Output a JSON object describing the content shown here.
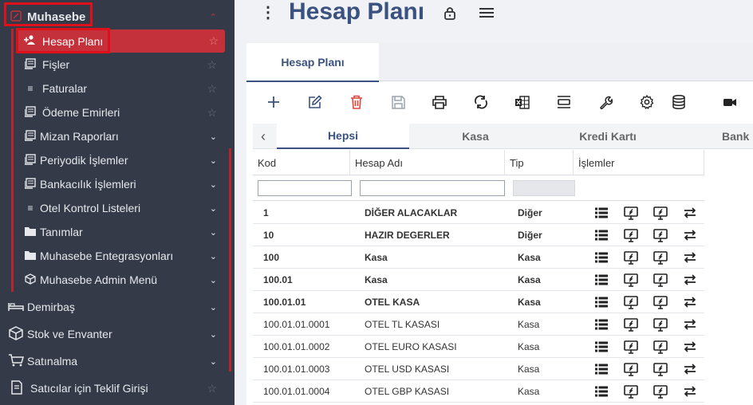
{
  "sidebar": {
    "module": {
      "label": "Muhasebe"
    },
    "items": [
      {
        "label": "Hesap Planı",
        "icon": "user-plus-icon"
      },
      {
        "label": "Fişler",
        "icon": "list-icon"
      },
      {
        "label": "Faturalar",
        "icon": "lines-icon"
      },
      {
        "label": "Ödeme Emirleri",
        "icon": "list-icon"
      },
      {
        "label": "Mizan Raporları",
        "icon": "list-icon"
      },
      {
        "label": "Periyodik İşlemler",
        "icon": "list-icon"
      },
      {
        "label": "Bankacılık İşlemleri",
        "icon": "list-icon"
      },
      {
        "label": "Otel Kontrol Listeleri",
        "icon": "lines-icon"
      },
      {
        "label": "Tanımlar",
        "icon": "folder-icon"
      },
      {
        "label": "Muhasebe Entegrasyonları",
        "icon": "folder-icon"
      },
      {
        "label": "Muhasebe Admin Menü",
        "icon": "cube-icon"
      }
    ],
    "modules": [
      {
        "label": "Demirbaş",
        "icon": "bed-icon"
      },
      {
        "label": "Stok ve Envanter",
        "icon": "box-icon"
      },
      {
        "label": "Satınalma",
        "icon": "cart-icon"
      },
      {
        "label": "Satıcılar için Teklif Girişi",
        "icon": "document-icon"
      }
    ]
  },
  "page": {
    "title": "Hesap Planı"
  },
  "panel_tab": {
    "label": "Hesap Planı"
  },
  "subtabs": [
    "Hepsi",
    "Kasa",
    "Kredi Kartı",
    "Bank"
  ],
  "grid": {
    "columns": [
      "Kod",
      "Hesap Adı",
      "Tip",
      "İşlemler"
    ],
    "rows": [
      {
        "kod": "1",
        "ad": "DİĞER ALACAKLAR",
        "tip": "Diğer",
        "bold": true
      },
      {
        "kod": "10",
        "ad": "HAZIR DEGERLER",
        "tip": "Diğer",
        "bold": true
      },
      {
        "kod": "100",
        "ad": "Kasa",
        "tip": "Kasa",
        "bold": true
      },
      {
        "kod": "100.01",
        "ad": "Kasa",
        "tip": "Kasa",
        "bold": true
      },
      {
        "kod": "100.01.01",
        "ad": "OTEL KASA",
        "tip": "Kasa",
        "bold": true
      },
      {
        "kod": "100.01.01.0001",
        "ad": "OTEL TL KASASI",
        "tip": "Kasa",
        "bold": false
      },
      {
        "kod": "100.01.01.0002",
        "ad": "OTEL EURO KASASI",
        "tip": "Kasa",
        "bold": false
      },
      {
        "kod": "100.01.01.0003",
        "ad": "OTEL USD KASASI",
        "tip": "Kasa",
        "bold": false
      },
      {
        "kod": "100.01.01.0004",
        "ad": "OTEL GBP KASASI",
        "tip": "Kasa",
        "bold": false
      }
    ]
  },
  "colors": {
    "sidebar_bg": "#343a47",
    "active": "#c4313a",
    "accent": "#3b5280",
    "delete": "#e0443b",
    "highlight": "#e0101a"
  }
}
